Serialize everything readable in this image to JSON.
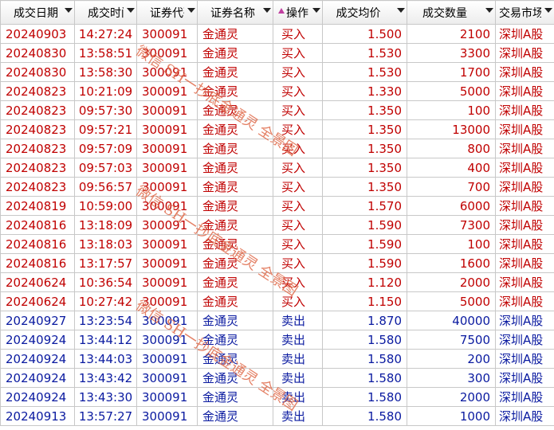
{
  "columns": [
    "成交日期",
    "成交时间",
    "证券代码",
    "证券名称",
    "操作",
    "成交均价",
    "成交数量",
    "交易市场"
  ],
  "rows": [
    {
      "type": "buy",
      "date": "20240903",
      "time": "14:27:24",
      "code": "300091",
      "name": "金通灵",
      "op": "买入",
      "price": "1.500",
      "qty": "2100",
      "market": "深圳A股"
    },
    {
      "type": "buy",
      "date": "20240830",
      "time": "13:58:51",
      "code": "300091",
      "name": "金通灵",
      "op": "买入",
      "price": "1.530",
      "qty": "3300",
      "market": "深圳A股"
    },
    {
      "type": "buy",
      "date": "20240830",
      "time": "13:58:30",
      "code": "300091",
      "name": "金通灵",
      "op": "买入",
      "price": "1.530",
      "qty": "1700",
      "market": "深圳A股"
    },
    {
      "type": "buy",
      "date": "20240823",
      "time": "10:21:09",
      "code": "300091",
      "name": "金通灵",
      "op": "买入",
      "price": "1.330",
      "qty": "5000",
      "market": "深圳A股"
    },
    {
      "type": "buy",
      "date": "20240823",
      "time": "09:57:30",
      "code": "300091",
      "name": "金通灵",
      "op": "买入",
      "price": "1.350",
      "qty": "100",
      "market": "深圳A股"
    },
    {
      "type": "buy",
      "date": "20240823",
      "time": "09:57:21",
      "code": "300091",
      "name": "金通灵",
      "op": "买入",
      "price": "1.350",
      "qty": "13000",
      "market": "深圳A股"
    },
    {
      "type": "buy",
      "date": "20240823",
      "time": "09:57:09",
      "code": "300091",
      "name": "金通灵",
      "op": "买入",
      "price": "1.350",
      "qty": "800",
      "market": "深圳A股"
    },
    {
      "type": "buy",
      "date": "20240823",
      "time": "09:57:03",
      "code": "300091",
      "name": "金通灵",
      "op": "买入",
      "price": "1.350",
      "qty": "400",
      "market": "深圳A股"
    },
    {
      "type": "buy",
      "date": "20240823",
      "time": "09:56:57",
      "code": "300091",
      "name": "金通灵",
      "op": "买入",
      "price": "1.350",
      "qty": "700",
      "market": "深圳A股"
    },
    {
      "type": "buy",
      "date": "20240819",
      "time": "10:59:00",
      "code": "300091",
      "name": "金通灵",
      "op": "买入",
      "price": "1.570",
      "qty": "6000",
      "market": "深圳A股"
    },
    {
      "type": "buy",
      "date": "20240816",
      "time": "13:18:09",
      "code": "300091",
      "name": "金通灵",
      "op": "买入",
      "price": "1.590",
      "qty": "7300",
      "market": "深圳A股"
    },
    {
      "type": "buy",
      "date": "20240816",
      "time": "13:18:03",
      "code": "300091",
      "name": "金通灵",
      "op": "买入",
      "price": "1.590",
      "qty": "100",
      "market": "深圳A股"
    },
    {
      "type": "buy",
      "date": "20240816",
      "time": "13:17:57",
      "code": "300091",
      "name": "金通灵",
      "op": "买入",
      "price": "1.590",
      "qty": "1600",
      "market": "深圳A股"
    },
    {
      "type": "buy",
      "date": "20240624",
      "time": "10:36:54",
      "code": "300091",
      "name": "金通灵",
      "op": "买入",
      "price": "1.120",
      "qty": "2000",
      "market": "深圳A股"
    },
    {
      "type": "buy",
      "date": "20240624",
      "time": "10:27:42",
      "code": "300091",
      "name": "金通灵",
      "op": "买入",
      "price": "1.150",
      "qty": "5000",
      "market": "深圳A股"
    },
    {
      "type": "sell",
      "date": "20240927",
      "time": "13:23:54",
      "code": "300091",
      "name": "金通灵",
      "op": "卖出",
      "price": "1.870",
      "qty": "40000",
      "market": "深圳A股"
    },
    {
      "type": "sell",
      "date": "20240924",
      "time": "13:44:12",
      "code": "300091",
      "name": "金通灵",
      "op": "卖出",
      "price": "1.580",
      "qty": "7500",
      "market": "深圳A股"
    },
    {
      "type": "sell",
      "date": "20240924",
      "time": "13:44:03",
      "code": "300091",
      "name": "金通灵",
      "op": "卖出",
      "price": "1.580",
      "qty": "200",
      "market": "深圳A股"
    },
    {
      "type": "sell",
      "date": "20240924",
      "time": "13:43:42",
      "code": "300091",
      "name": "金通灵",
      "op": "卖出",
      "price": "1.580",
      "qty": "300",
      "market": "深圳A股"
    },
    {
      "type": "sell",
      "date": "20240924",
      "time": "13:43:30",
      "code": "300091",
      "name": "金通灵",
      "op": "卖出",
      "price": "1.580",
      "qty": "2000",
      "market": "深圳A股"
    },
    {
      "type": "sell",
      "date": "20240913",
      "time": "13:57:27",
      "code": "300091",
      "name": "金通灵",
      "op": "卖出",
      "price": "1.580",
      "qty": "1000",
      "market": "深圳A股"
    }
  ],
  "watermark": "微信 SH一抄底金通灵 全景图",
  "colors": {
    "buy": "#c00000",
    "sell": "#0a1aa0",
    "watermark": "#e06a4a"
  }
}
